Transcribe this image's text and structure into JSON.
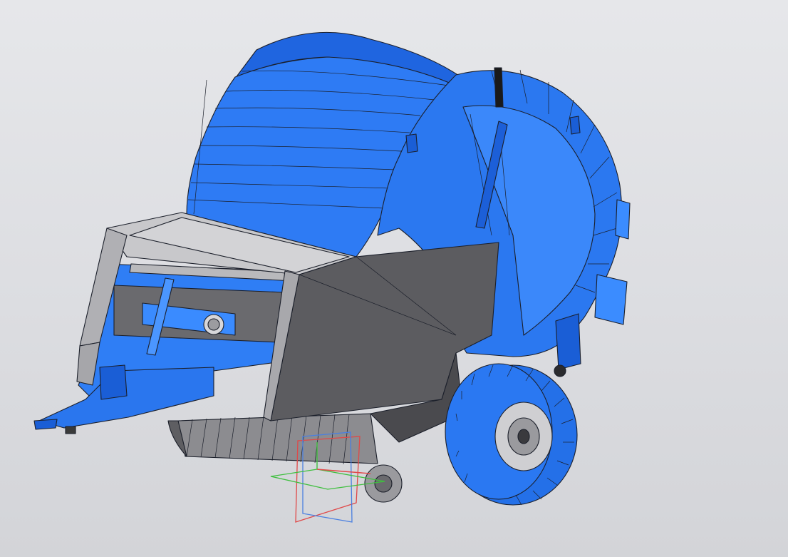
{
  "viewport": {
    "background": "#dcdde1",
    "model": {
      "colors": {
        "blue_body": "#2f7cf2",
        "blue_light": "#4a97ff",
        "blue_dark": "#1a5ed6",
        "gray_panel": "#5e5e62",
        "gray_light": "#c9c9cc",
        "gray_mid": "#8a8a8e",
        "edge": "#1b1f2a"
      }
    },
    "triad": {
      "colors": {
        "x": "#e04848",
        "y": "#3fbf3f",
        "z": "#4a7fe0"
      }
    }
  }
}
